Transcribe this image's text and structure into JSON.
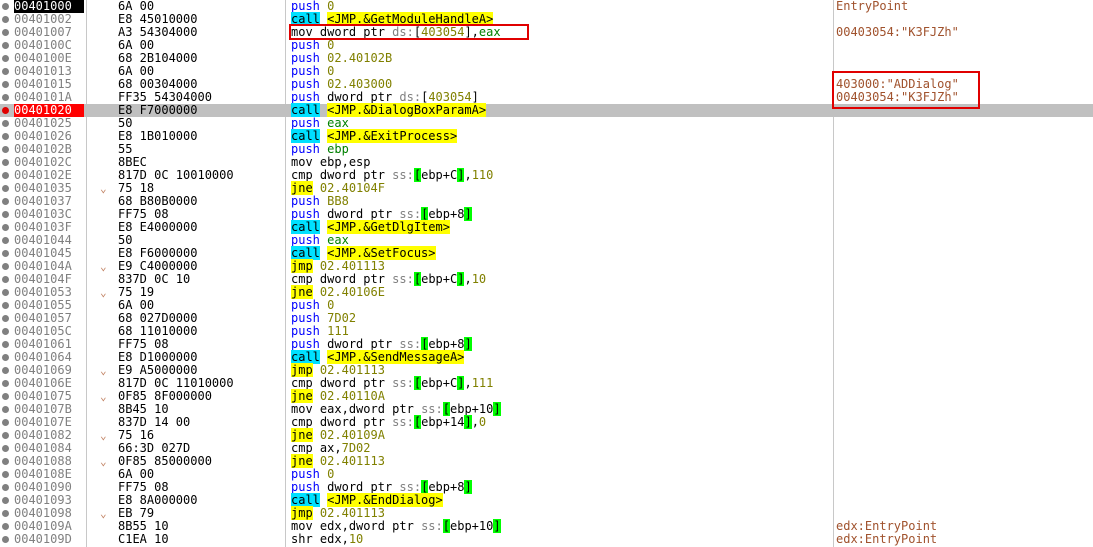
{
  "rows": [
    {
      "addr": "00401000",
      "bytes": "6A 00",
      "mn": "push",
      "ops": [
        {
          "t": "0",
          "c": "num"
        }
      ],
      "comment": "EntryPoint",
      "sel": true
    },
    {
      "addr": "00401002",
      "bytes": "E8 45010000",
      "mn": "call",
      "ops": [
        {
          "t": "<JMP.&GetModuleHandleA>",
          "c": "tgt"
        }
      ]
    },
    {
      "addr": "00401007",
      "bytes": "A3 54304000",
      "mn": "mov",
      "ops": [
        {
          "t": "dword ptr ",
          "c": "t"
        },
        {
          "t": "ds:",
          "c": "seg"
        },
        {
          "t": "[",
          "c": "t"
        },
        {
          "t": "403054",
          "c": "num"
        },
        {
          "t": "],",
          "c": "t"
        },
        {
          "t": "eax",
          "c": "reg"
        }
      ],
      "comment": "00403054:\"K3FJZh\""
    },
    {
      "addr": "0040100C",
      "bytes": "6A 00",
      "mn": "push",
      "ops": [
        {
          "t": "0",
          "c": "num"
        }
      ]
    },
    {
      "addr": "0040100E",
      "bytes": "68 2B104000",
      "mn": "push",
      "ops": [
        {
          "t": "02.40102B",
          "c": "num"
        }
      ]
    },
    {
      "addr": "00401013",
      "bytes": "6A 00",
      "mn": "push",
      "ops": [
        {
          "t": "0",
          "c": "num"
        }
      ]
    },
    {
      "addr": "00401015",
      "bytes": "68 00304000",
      "mn": "push",
      "ops": [
        {
          "t": "02.403000",
          "c": "num"
        }
      ],
      "comment": "403000:\"ADDialog\""
    },
    {
      "addr": "0040101A",
      "bytes": "FF35 54304000",
      "mn": "push",
      "ops": [
        {
          "t": "dword ptr ",
          "c": "t"
        },
        {
          "t": "ds:",
          "c": "seg"
        },
        {
          "t": "[",
          "c": "t"
        },
        {
          "t": "403054",
          "c": "num"
        },
        {
          "t": "]",
          "c": "t"
        }
      ],
      "comment": "00403054:\"K3FJZh\""
    },
    {
      "addr": "00401020",
      "bytes": "E8 F7000000",
      "mn": "call",
      "ops": [
        {
          "t": "<JMP.&DialogBoxParamA>",
          "c": "tgt"
        }
      ],
      "bp": true,
      "hl": true
    },
    {
      "addr": "00401025",
      "bytes": "50",
      "mn": "push",
      "ops": [
        {
          "t": "eax",
          "c": "reg"
        }
      ]
    },
    {
      "addr": "00401026",
      "bytes": "E8 1B010000",
      "mn": "call",
      "ops": [
        {
          "t": "<JMP.&ExitProcess>",
          "c": "tgt"
        }
      ]
    },
    {
      "addr": "0040102B",
      "bytes": "55",
      "mn": "push",
      "ops": [
        {
          "t": "ebp",
          "c": "reg"
        }
      ]
    },
    {
      "addr": "0040102C",
      "bytes": "8BEC",
      "mn": "mov",
      "ops": [
        {
          "t": "ebp,esp",
          "c": "t"
        }
      ]
    },
    {
      "addr": "0040102E",
      "bytes": "817D 0C 10010000",
      "mn": "cmp",
      "ops": [
        {
          "t": "dword ptr ",
          "c": "t"
        },
        {
          "t": "ss:",
          "c": "seg"
        },
        {
          "t": "[",
          "c": "brk"
        },
        {
          "t": "ebp+C",
          "c": "t"
        },
        {
          "t": "]",
          "c": "brk"
        },
        {
          "t": ",",
          "c": "t"
        },
        {
          "t": "110",
          "c": "num"
        }
      ]
    },
    {
      "addr": "00401035",
      "bytes": "75 18",
      "mn": "jne",
      "ops": [
        {
          "t": "02.40104F",
          "c": "num"
        }
      ],
      "arrow": "⌄"
    },
    {
      "addr": "00401037",
      "bytes": "68 B80B0000",
      "mn": "push",
      "ops": [
        {
          "t": "BB8",
          "c": "num"
        }
      ]
    },
    {
      "addr": "0040103C",
      "bytes": "FF75 08",
      "mn": "push",
      "ops": [
        {
          "t": "dword ptr ",
          "c": "t"
        },
        {
          "t": "ss:",
          "c": "seg"
        },
        {
          "t": "[",
          "c": "brk"
        },
        {
          "t": "ebp+8",
          "c": "t"
        },
        {
          "t": "]",
          "c": "brk"
        }
      ]
    },
    {
      "addr": "0040103F",
      "bytes": "E8 E4000000",
      "mn": "call",
      "ops": [
        {
          "t": "<JMP.&GetDlgItem>",
          "c": "tgt"
        }
      ]
    },
    {
      "addr": "00401044",
      "bytes": "50",
      "mn": "push",
      "ops": [
        {
          "t": "eax",
          "c": "reg"
        }
      ]
    },
    {
      "addr": "00401045",
      "bytes": "E8 F6000000",
      "mn": "call",
      "ops": [
        {
          "t": "<JMP.&SetFocus>",
          "c": "tgt"
        }
      ]
    },
    {
      "addr": "0040104A",
      "bytes": "E9 C4000000",
      "mn": "jmp",
      "ops": [
        {
          "t": "02.401113",
          "c": "num"
        }
      ],
      "arrow": "⌄"
    },
    {
      "addr": "0040104F",
      "bytes": "837D 0C 10",
      "mn": "cmp",
      "ops": [
        {
          "t": "dword ptr ",
          "c": "t"
        },
        {
          "t": "ss:",
          "c": "seg"
        },
        {
          "t": "[",
          "c": "brk"
        },
        {
          "t": "ebp+C",
          "c": "t"
        },
        {
          "t": "]",
          "c": "brk"
        },
        {
          "t": ",",
          "c": "t"
        },
        {
          "t": "10",
          "c": "num"
        }
      ]
    },
    {
      "addr": "00401053",
      "bytes": "75 19",
      "mn": "jne",
      "ops": [
        {
          "t": "02.40106E",
          "c": "num"
        }
      ],
      "arrow": "⌄"
    },
    {
      "addr": "00401055",
      "bytes": "6A 00",
      "mn": "push",
      "ops": [
        {
          "t": "0",
          "c": "num"
        }
      ]
    },
    {
      "addr": "00401057",
      "bytes": "68 027D0000",
      "mn": "push",
      "ops": [
        {
          "t": "7D02",
          "c": "num"
        }
      ]
    },
    {
      "addr": "0040105C",
      "bytes": "68 11010000",
      "mn": "push",
      "ops": [
        {
          "t": "111",
          "c": "num"
        }
      ]
    },
    {
      "addr": "00401061",
      "bytes": "FF75 08",
      "mn": "push",
      "ops": [
        {
          "t": "dword ptr ",
          "c": "t"
        },
        {
          "t": "ss:",
          "c": "seg"
        },
        {
          "t": "[",
          "c": "brk"
        },
        {
          "t": "ebp+8",
          "c": "t"
        },
        {
          "t": "]",
          "c": "brk"
        }
      ]
    },
    {
      "addr": "00401064",
      "bytes": "E8 D1000000",
      "mn": "call",
      "ops": [
        {
          "t": "<JMP.&SendMessageA>",
          "c": "tgt"
        }
      ]
    },
    {
      "addr": "00401069",
      "bytes": "E9 A5000000",
      "mn": "jmp",
      "ops": [
        {
          "t": "02.401113",
          "c": "num"
        }
      ],
      "arrow": "⌄"
    },
    {
      "addr": "0040106E",
      "bytes": "817D 0C 11010000",
      "mn": "cmp",
      "ops": [
        {
          "t": "dword ptr ",
          "c": "t"
        },
        {
          "t": "ss:",
          "c": "seg"
        },
        {
          "t": "[",
          "c": "brk"
        },
        {
          "t": "ebp+C",
          "c": "t"
        },
        {
          "t": "]",
          "c": "brk"
        },
        {
          "t": ",",
          "c": "t"
        },
        {
          "t": "111",
          "c": "num"
        }
      ]
    },
    {
      "addr": "00401075",
      "bytes": "0F85 8F000000",
      "mn": "jne",
      "ops": [
        {
          "t": "02.40110A",
          "c": "num"
        }
      ],
      "arrow": "⌄"
    },
    {
      "addr": "0040107B",
      "bytes": "8B45 10",
      "mn": "mov",
      "ops": [
        {
          "t": "eax,dword ptr ",
          "c": "t"
        },
        {
          "t": "ss:",
          "c": "seg"
        },
        {
          "t": "[",
          "c": "brk"
        },
        {
          "t": "ebp+10",
          "c": "t"
        },
        {
          "t": "]",
          "c": "brk"
        }
      ]
    },
    {
      "addr": "0040107E",
      "bytes": "837D 14 00",
      "mn": "cmp",
      "ops": [
        {
          "t": "dword ptr ",
          "c": "t"
        },
        {
          "t": "ss:",
          "c": "seg"
        },
        {
          "t": "[",
          "c": "brk"
        },
        {
          "t": "ebp+14",
          "c": "t"
        },
        {
          "t": "]",
          "c": "brk"
        },
        {
          "t": ",",
          "c": "t"
        },
        {
          "t": "0",
          "c": "num"
        }
      ]
    },
    {
      "addr": "00401082",
      "bytes": "75 16",
      "mn": "jne",
      "ops": [
        {
          "t": "02.40109A",
          "c": "num"
        }
      ],
      "arrow": "⌄"
    },
    {
      "addr": "00401084",
      "bytes": "66:3D 027D",
      "mn": "cmp",
      "ops": [
        {
          "t": "ax,",
          "c": "t"
        },
        {
          "t": "7D02",
          "c": "num"
        }
      ]
    },
    {
      "addr": "00401088",
      "bytes": "0F85 85000000",
      "mn": "jne",
      "ops": [
        {
          "t": "02.401113",
          "c": "num"
        }
      ],
      "arrow": "⌄"
    },
    {
      "addr": "0040108E",
      "bytes": "6A 00",
      "mn": "push",
      "ops": [
        {
          "t": "0",
          "c": "num"
        }
      ]
    },
    {
      "addr": "00401090",
      "bytes": "FF75 08",
      "mn": "push",
      "ops": [
        {
          "t": "dword ptr ",
          "c": "t"
        },
        {
          "t": "ss:",
          "c": "seg"
        },
        {
          "t": "[",
          "c": "brk"
        },
        {
          "t": "ebp+8",
          "c": "t"
        },
        {
          "t": "]",
          "c": "brk"
        }
      ]
    },
    {
      "addr": "00401093",
      "bytes": "E8 8A000000",
      "mn": "call",
      "ops": [
        {
          "t": "<JMP.&EndDialog>",
          "c": "tgt"
        }
      ]
    },
    {
      "addr": "00401098",
      "bytes": "EB 79",
      "mn": "jmp",
      "ops": [
        {
          "t": "02.401113",
          "c": "num"
        }
      ],
      "arrow": "⌄"
    },
    {
      "addr": "0040109A",
      "bytes": "8B55 10",
      "mn": "mov",
      "ops": [
        {
          "t": "edx,dword ptr ",
          "c": "t"
        },
        {
          "t": "ss:",
          "c": "seg"
        },
        {
          "t": "[",
          "c": "brk"
        },
        {
          "t": "ebp+10",
          "c": "t"
        },
        {
          "t": "]",
          "c": "brk"
        }
      ],
      "comment": "edx:EntryPoint"
    },
    {
      "addr": "0040109D",
      "bytes": "C1EA 10",
      "mn": "shr",
      "ops": [
        {
          "t": "edx,",
          "c": "t"
        },
        {
          "t": "10",
          "c": "num"
        }
      ],
      "comment": "edx:EntryPoint"
    }
  ],
  "colors": {
    "call_bg": "#00e0ff",
    "jump_bg": "#ffff00",
    "highlight_row": "#c0c0c0",
    "breakpoint": "#e00000",
    "annotation_box": "#e00000"
  }
}
